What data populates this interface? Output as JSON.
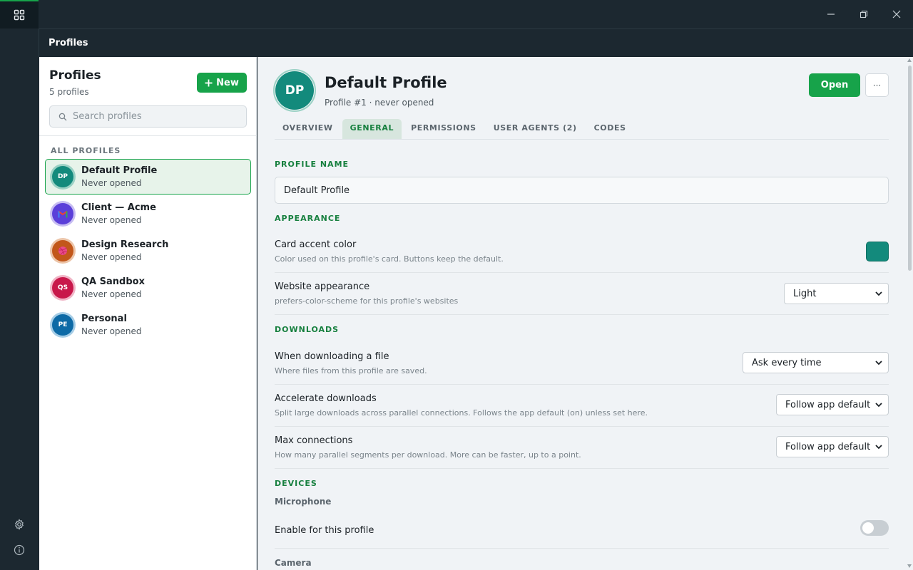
{
  "header": {
    "title": "Profiles"
  },
  "sidebar": {
    "title": "Profiles",
    "count": "5 profiles",
    "new_label": "New",
    "search_placeholder": "Search profiles",
    "section_label": "ALL PROFILES",
    "items": [
      {
        "name": "Default Profile",
        "status": "Never opened",
        "initials": "DP",
        "color": "#138a7c",
        "ring": "#9ad1c4",
        "active": true
      },
      {
        "name": "Client — Acme",
        "status": "Never opened",
        "initials": "",
        "icon": "gmail-icon",
        "color": "#5b3fd9",
        "ring": "#c7bdf2",
        "active": false
      },
      {
        "name": "Design Research",
        "status": "Never opened",
        "initials": "",
        "icon": "dribbble-icon",
        "color": "#c2571a",
        "ring": "#ecc4a8",
        "active": false
      },
      {
        "name": "QA Sandbox",
        "status": "Never opened",
        "initials": "QS",
        "color": "#c8174a",
        "ring": "#f0b3c5",
        "active": false
      },
      {
        "name": "Personal",
        "status": "Never opened",
        "initials": "PE",
        "color": "#0d6aa6",
        "ring": "#a6cde6",
        "active": false
      }
    ]
  },
  "profile": {
    "initials": "DP",
    "title": "Default Profile",
    "subtitle": "Profile #1 · never opened",
    "open_label": "Open",
    "more_label": "···"
  },
  "tabs": [
    {
      "label": "OVERVIEW",
      "active": false
    },
    {
      "label": "GENERAL",
      "active": true
    },
    {
      "label": "PERMISSIONS",
      "active": false
    },
    {
      "label": "USER AGENTS (2)",
      "active": false
    },
    {
      "label": "CODES",
      "active": false
    }
  ],
  "general": {
    "profile_name_heading": "PROFILE NAME",
    "profile_name_value": "Default Profile",
    "appearance_heading": "APPEARANCE",
    "card_accent_title": "Card accent color",
    "card_accent_desc": "Color used on this profile's card. Buttons keep the default.",
    "card_accent_color": "#138a7c",
    "website_appearance_title": "Website appearance",
    "website_appearance_desc": "prefers-color-scheme for this profile's websites",
    "website_appearance_value": "Light",
    "downloads_heading": "DOWNLOADS",
    "download_file_title": "When downloading a file",
    "download_file_desc": "Where files from this profile are saved.",
    "download_file_value": "Ask every time",
    "accelerate_title": "Accelerate downloads",
    "accelerate_desc": "Split large downloads across parallel connections. Follows the app default (on) unless set here.",
    "accelerate_value": "Follow app default",
    "max_conn_title": "Max connections",
    "max_conn_desc": "How many parallel segments per download. More can be faster, up to a point.",
    "max_conn_value": "Follow app default",
    "devices_heading": "DEVICES",
    "microphone_heading": "Microphone",
    "mic_enable_title": "Enable for this profile",
    "mic_enabled": false,
    "camera_heading": "Camera"
  },
  "colors": {
    "accent": "#17a34a",
    "accent_dark": "#17803f",
    "titlebar": "#1c2830"
  }
}
